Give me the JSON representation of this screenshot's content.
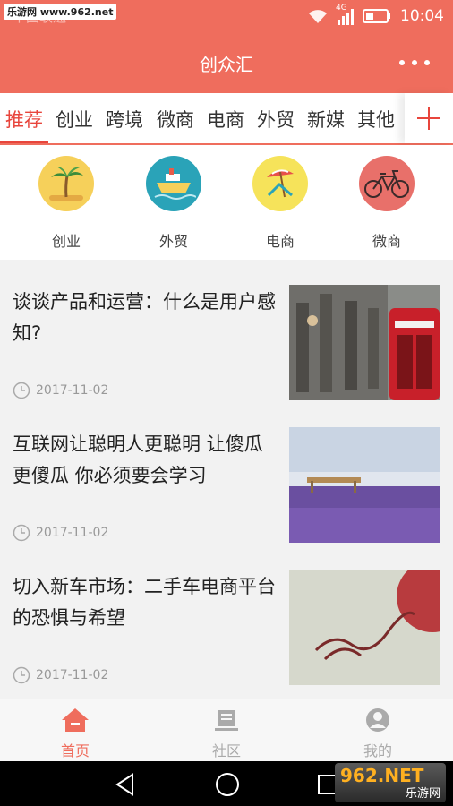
{
  "status_bar": {
    "watermark": "乐游网 www.962.net",
    "carrier": "中国联通",
    "network": "4G",
    "time": "10:04"
  },
  "app_bar": {
    "title": "创众汇"
  },
  "tabs": [
    {
      "label": "推荐",
      "active": true
    },
    {
      "label": "创业"
    },
    {
      "label": "跨境"
    },
    {
      "label": "微商"
    },
    {
      "label": "电商"
    },
    {
      "label": "外贸"
    },
    {
      "label": "新媒"
    },
    {
      "label": "其他"
    }
  ],
  "categories": [
    {
      "label": "创业",
      "icon": "palm-tree-icon",
      "color": "#f6d05a"
    },
    {
      "label": "外贸",
      "icon": "ship-icon",
      "color": "#2aa3b8"
    },
    {
      "label": "电商",
      "icon": "beach-chair-icon",
      "color": "#f6e35a"
    },
    {
      "label": "微商",
      "icon": "bicycle-icon",
      "color": "#e8706a"
    }
  ],
  "articles": [
    {
      "title": "谈谈产品和运营：什么是用户感知?",
      "date": "2017-11-02",
      "thumbnail": "london-street-phone-booth"
    },
    {
      "title": "互联网让聪明人更聪明 让傻瓜更傻瓜 你必须要会学习",
      "date": "2017-11-02",
      "thumbnail": "lavender-field"
    },
    {
      "title": "切入新车市场：二手车电商平台的恐惧与希望",
      "date": "2017-11-02",
      "thumbnail": "be-happy-sand"
    }
  ],
  "bottom_nav": [
    {
      "label": "首页",
      "icon": "home-icon",
      "active": true
    },
    {
      "label": "社区",
      "icon": "coffee-icon"
    },
    {
      "label": "我的",
      "icon": "user-icon"
    }
  ],
  "logo": {
    "text": "962.NET",
    "subtext": "乐游网"
  },
  "colors": {
    "primary": "#ef6d5d",
    "active_tab": "#e8453c",
    "text": "#222222",
    "muted": "#999999"
  }
}
